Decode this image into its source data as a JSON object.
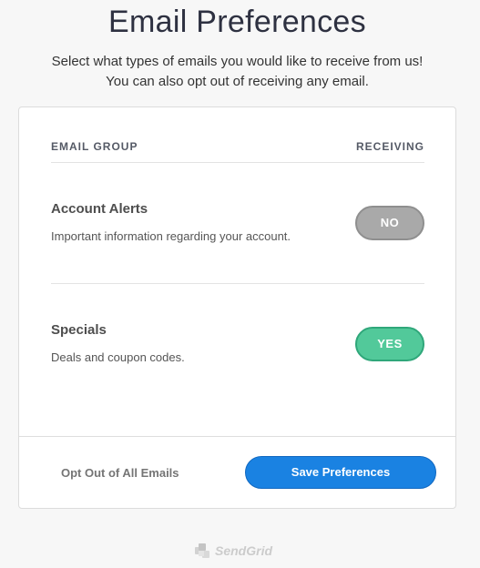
{
  "header": {
    "title": "Email Preferences",
    "subtitle_line1": "Select what types of emails you would like to receive from us!",
    "subtitle_line2": "You can also opt out of receiving any email."
  },
  "table": {
    "col_group": "EMAIL GROUP",
    "col_receiving": "RECEIVING"
  },
  "groups": [
    {
      "name": "Account Alerts",
      "description": "Important information regarding your account.",
      "receiving": "NO"
    },
    {
      "name": "Specials",
      "description": "Deals and coupon codes.",
      "receiving": "YES"
    }
  ],
  "footer": {
    "opt_out_label": "Opt Out of All Emails",
    "save_label": "Save Preferences"
  },
  "brand": {
    "name": "SendGrid",
    "logo_icon": "sendgrid-logo-icon"
  },
  "colors": {
    "toggle_no": "#a9a9a9",
    "toggle_yes": "#52c99a",
    "save_button": "#1a82e2"
  }
}
